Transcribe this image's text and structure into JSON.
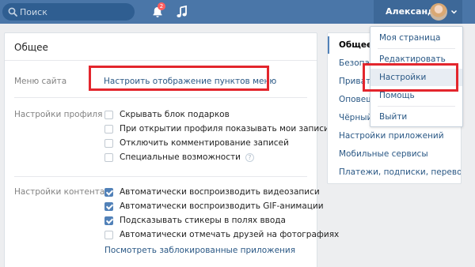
{
  "header": {
    "search_placeholder": "Поиск",
    "notification_count": "2",
    "user_name": "Александр"
  },
  "main": {
    "title": "Общее",
    "menu_row": {
      "label": "Меню сайта",
      "link": "Настроить отображение пунктов меню"
    },
    "profile_settings": {
      "label": "Настройки профиля",
      "items": [
        {
          "text": "Скрывать блок подарков",
          "checked": false
        },
        {
          "text": "При открытии профиля показывать мои записи",
          "checked": false
        },
        {
          "text": "Отключить комментирование записей",
          "checked": false
        },
        {
          "text": "Специальные возможности",
          "checked": false
        }
      ],
      "help_glyph": "?"
    },
    "content_settings": {
      "label": "Настройки контента",
      "items": [
        {
          "text": "Автоматически воспроизводить видеозаписи",
          "checked": true
        },
        {
          "text": "Автоматически воспроизводить GIF-анимации",
          "checked": true
        },
        {
          "text": "Подсказывать стикеры в полях ввода",
          "checked": true
        },
        {
          "text": "Автоматически отмечать друзей на фотографиях",
          "checked": false
        }
      ],
      "blocked_apps_link": "Посмотреть заблокированные приложения"
    }
  },
  "settings_menu": {
    "items": [
      "Общее",
      "Безопасность",
      "Приватность",
      "Оповещения",
      "Чёрный список",
      "Настройки приложений",
      "Мобильные сервисы",
      "Платежи, подписки, переводы"
    ]
  },
  "user_dropdown": {
    "items": [
      "Моя страница",
      "Редактировать",
      "Настройки",
      "Помощь",
      "Выйти"
    ],
    "highlighted": "Настройки"
  },
  "colors": {
    "header": "#4a76a8",
    "link": "#2a5885",
    "checkbox_checked": "#5181b8",
    "highlight_box": "#e3262d",
    "page_bg": "#edeef0"
  },
  "icons": [
    "search-icon",
    "bell-icon",
    "music-icon",
    "chevron-down-icon",
    "question-icon"
  ]
}
